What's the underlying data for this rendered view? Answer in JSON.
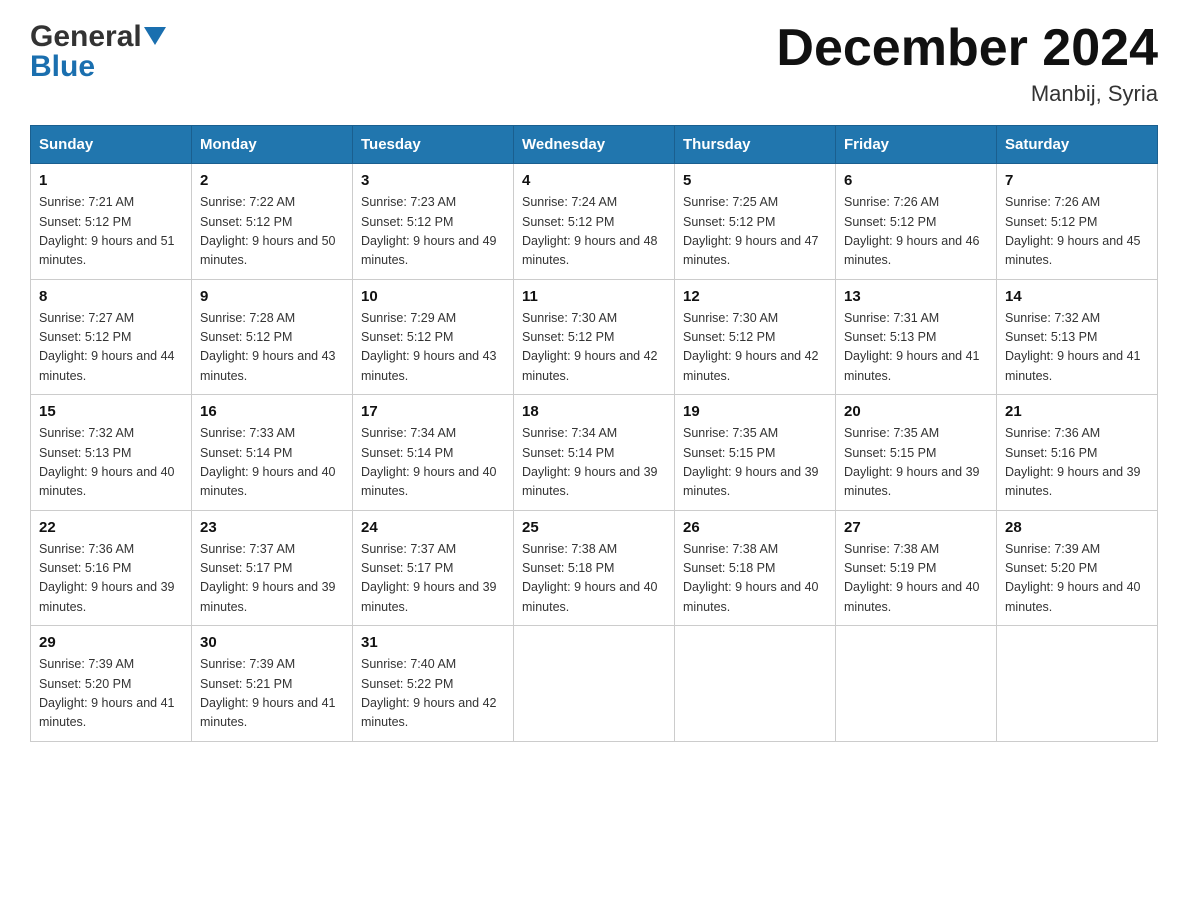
{
  "header": {
    "logo_general": "General",
    "logo_blue": "Blue",
    "month_title": "December 2024",
    "location": "Manbij, Syria"
  },
  "days_of_week": [
    "Sunday",
    "Monday",
    "Tuesday",
    "Wednesday",
    "Thursday",
    "Friday",
    "Saturday"
  ],
  "weeks": [
    [
      {
        "day": "1",
        "sunrise": "7:21 AM",
        "sunset": "5:12 PM",
        "daylight": "9 hours and 51 minutes."
      },
      {
        "day": "2",
        "sunrise": "7:22 AM",
        "sunset": "5:12 PM",
        "daylight": "9 hours and 50 minutes."
      },
      {
        "day": "3",
        "sunrise": "7:23 AM",
        "sunset": "5:12 PM",
        "daylight": "9 hours and 49 minutes."
      },
      {
        "day": "4",
        "sunrise": "7:24 AM",
        "sunset": "5:12 PM",
        "daylight": "9 hours and 48 minutes."
      },
      {
        "day": "5",
        "sunrise": "7:25 AM",
        "sunset": "5:12 PM",
        "daylight": "9 hours and 47 minutes."
      },
      {
        "day": "6",
        "sunrise": "7:26 AM",
        "sunset": "5:12 PM",
        "daylight": "9 hours and 46 minutes."
      },
      {
        "day": "7",
        "sunrise": "7:26 AM",
        "sunset": "5:12 PM",
        "daylight": "9 hours and 45 minutes."
      }
    ],
    [
      {
        "day": "8",
        "sunrise": "7:27 AM",
        "sunset": "5:12 PM",
        "daylight": "9 hours and 44 minutes."
      },
      {
        "day": "9",
        "sunrise": "7:28 AM",
        "sunset": "5:12 PM",
        "daylight": "9 hours and 43 minutes."
      },
      {
        "day": "10",
        "sunrise": "7:29 AM",
        "sunset": "5:12 PM",
        "daylight": "9 hours and 43 minutes."
      },
      {
        "day": "11",
        "sunrise": "7:30 AM",
        "sunset": "5:12 PM",
        "daylight": "9 hours and 42 minutes."
      },
      {
        "day": "12",
        "sunrise": "7:30 AM",
        "sunset": "5:12 PM",
        "daylight": "9 hours and 42 minutes."
      },
      {
        "day": "13",
        "sunrise": "7:31 AM",
        "sunset": "5:13 PM",
        "daylight": "9 hours and 41 minutes."
      },
      {
        "day": "14",
        "sunrise": "7:32 AM",
        "sunset": "5:13 PM",
        "daylight": "9 hours and 41 minutes."
      }
    ],
    [
      {
        "day": "15",
        "sunrise": "7:32 AM",
        "sunset": "5:13 PM",
        "daylight": "9 hours and 40 minutes."
      },
      {
        "day": "16",
        "sunrise": "7:33 AM",
        "sunset": "5:14 PM",
        "daylight": "9 hours and 40 minutes."
      },
      {
        "day": "17",
        "sunrise": "7:34 AM",
        "sunset": "5:14 PM",
        "daylight": "9 hours and 40 minutes."
      },
      {
        "day": "18",
        "sunrise": "7:34 AM",
        "sunset": "5:14 PM",
        "daylight": "9 hours and 39 minutes."
      },
      {
        "day": "19",
        "sunrise": "7:35 AM",
        "sunset": "5:15 PM",
        "daylight": "9 hours and 39 minutes."
      },
      {
        "day": "20",
        "sunrise": "7:35 AM",
        "sunset": "5:15 PM",
        "daylight": "9 hours and 39 minutes."
      },
      {
        "day": "21",
        "sunrise": "7:36 AM",
        "sunset": "5:16 PM",
        "daylight": "9 hours and 39 minutes."
      }
    ],
    [
      {
        "day": "22",
        "sunrise": "7:36 AM",
        "sunset": "5:16 PM",
        "daylight": "9 hours and 39 minutes."
      },
      {
        "day": "23",
        "sunrise": "7:37 AM",
        "sunset": "5:17 PM",
        "daylight": "9 hours and 39 minutes."
      },
      {
        "day": "24",
        "sunrise": "7:37 AM",
        "sunset": "5:17 PM",
        "daylight": "9 hours and 39 minutes."
      },
      {
        "day": "25",
        "sunrise": "7:38 AM",
        "sunset": "5:18 PM",
        "daylight": "9 hours and 40 minutes."
      },
      {
        "day": "26",
        "sunrise": "7:38 AM",
        "sunset": "5:18 PM",
        "daylight": "9 hours and 40 minutes."
      },
      {
        "day": "27",
        "sunrise": "7:38 AM",
        "sunset": "5:19 PM",
        "daylight": "9 hours and 40 minutes."
      },
      {
        "day": "28",
        "sunrise": "7:39 AM",
        "sunset": "5:20 PM",
        "daylight": "9 hours and 40 minutes."
      }
    ],
    [
      {
        "day": "29",
        "sunrise": "7:39 AM",
        "sunset": "5:20 PM",
        "daylight": "9 hours and 41 minutes."
      },
      {
        "day": "30",
        "sunrise": "7:39 AM",
        "sunset": "5:21 PM",
        "daylight": "9 hours and 41 minutes."
      },
      {
        "day": "31",
        "sunrise": "7:40 AM",
        "sunset": "5:22 PM",
        "daylight": "9 hours and 42 minutes."
      },
      null,
      null,
      null,
      null
    ]
  ]
}
